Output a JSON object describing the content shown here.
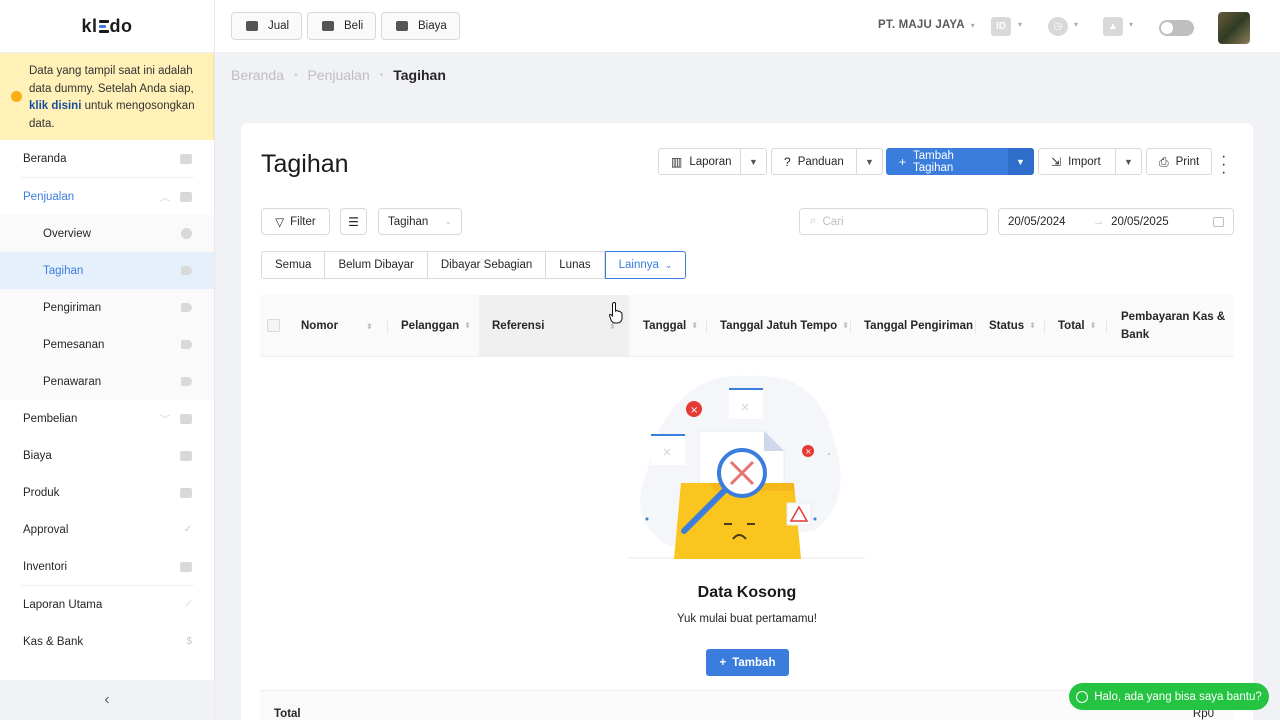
{
  "app": {
    "logo_text_left": "kl",
    "logo_text_right": "do"
  },
  "notice": {
    "text_before": "Data yang tampil saat ini adalah data dummy. Setelah Anda siap, ",
    "link": "klik disini",
    "text_after": " untuk mengosongkan data."
  },
  "sidebar": {
    "items": [
      {
        "label": "Beranda",
        "icon": "home-icon"
      },
      {
        "label": "Penjualan",
        "icon": "basket-icon"
      },
      {
        "label": "Overview",
        "icon": "pie-chart-icon"
      },
      {
        "label": "Tagihan",
        "icon": "tag-icon"
      },
      {
        "label": "Pengiriman",
        "icon": "tag-icon"
      },
      {
        "label": "Pemesanan",
        "icon": "tag-icon"
      },
      {
        "label": "Penawaran",
        "icon": "tag-icon"
      },
      {
        "label": "Pembelian",
        "icon": "bag-icon"
      },
      {
        "label": "Biaya",
        "icon": "card-icon"
      },
      {
        "label": "Produk",
        "icon": "box-icon"
      },
      {
        "label": "Approval",
        "icon": "check-icon"
      },
      {
        "label": "Inventori",
        "icon": "warehouse-icon"
      },
      {
        "label": "Laporan Utama",
        "icon": "chart-icon"
      },
      {
        "label": "Kas & Bank",
        "icon": "dollar-icon"
      }
    ],
    "collapse": "‹"
  },
  "topbar": {
    "jual": "Jual",
    "beli": "Beli",
    "biaya": "Biaya",
    "company": "PT. MAJU JAYA",
    "lang": "ID"
  },
  "breadcrumb": {
    "home": "Beranda",
    "section": "Penjualan",
    "current": "Tagihan"
  },
  "page": {
    "title": "Tagihan",
    "actions": {
      "laporan": "Laporan",
      "panduan": "Panduan",
      "tambah": "Tambah Tagihan",
      "import": "Import",
      "print": "Print"
    },
    "filter": "Filter",
    "select_value": "Tagihan",
    "search_placeholder": "Cari",
    "date_from": "20/05/2024",
    "date_to": "20/05/2025"
  },
  "tabs": [
    "Semua",
    "Belum Dibayar",
    "Dibayar Sebagian",
    "Lunas",
    "Lainnya"
  ],
  "table": {
    "columns": [
      "Nomor",
      "Pelanggan",
      "Referensi",
      "Tanggal",
      "Tanggal Jatuh Tempo",
      "Tanggal Pengiriman",
      "Status",
      "Total",
      "Pembayaran Kas & Bank"
    ]
  },
  "empty": {
    "title": "Data Kosong",
    "subtitle": "Yuk mulai buat pertamamu!",
    "button": "Tambah"
  },
  "footer": {
    "label": "Total",
    "value": "Rp0"
  },
  "whatsapp": "Halo, ada yang bisa saya bantu?",
  "colors": {
    "accent": "#3b7ddd",
    "notice_bg": "#fff1b8",
    "whatsapp": "#25c342"
  }
}
